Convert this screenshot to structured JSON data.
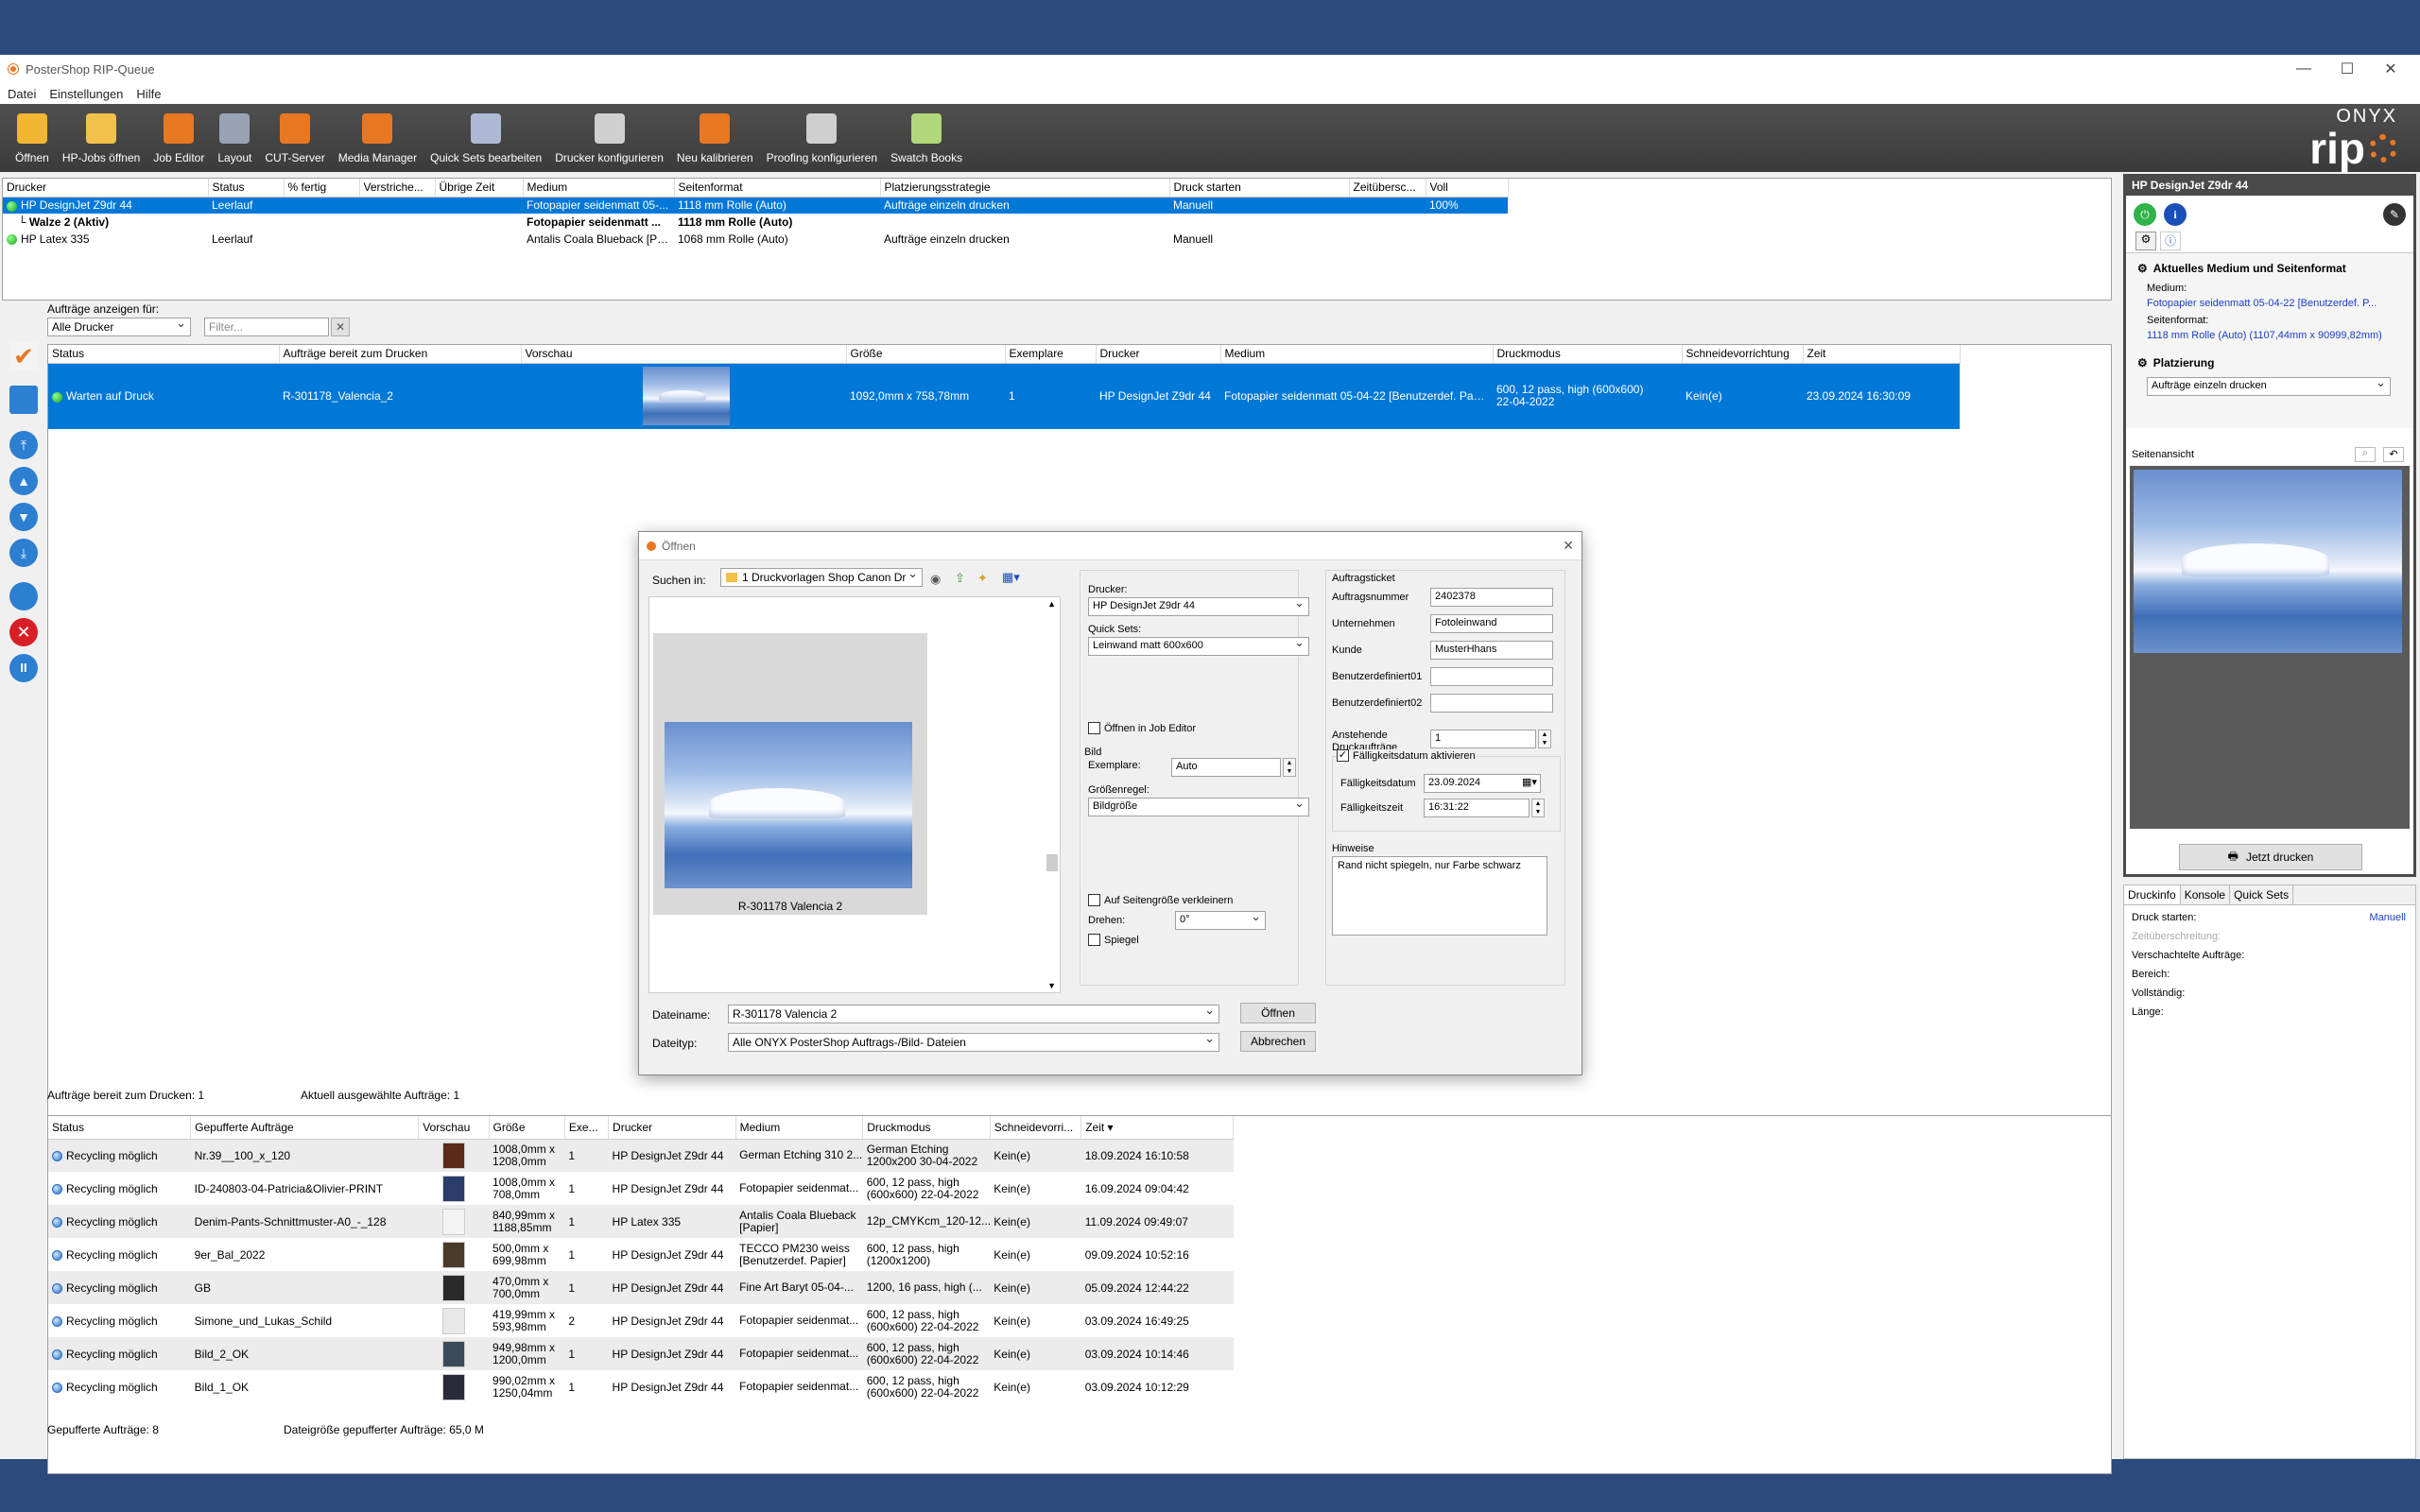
{
  "window": {
    "title": "PosterShop RIP-Queue",
    "minimize": "—",
    "maximize": "☐",
    "close": "✕"
  },
  "menu": [
    "Datei",
    "Einstellungen",
    "Hilfe"
  ],
  "toolbar": [
    {
      "label": "Öffnen",
      "icon": "folder-icon",
      "color": "#f2b632"
    },
    {
      "label": "HP-Jobs öffnen",
      "icon": "hp-folder-icon",
      "color": "#f2c14a"
    },
    {
      "label": "Job Editor",
      "icon": "job-editor-icon",
      "color": "#e87722"
    },
    {
      "label": "Layout",
      "icon": "layout-icon",
      "color": "#9aa3b5"
    },
    {
      "label": "CUT-Server",
      "icon": "cut-server-icon",
      "color": "#e87722"
    },
    {
      "label": "Media Manager",
      "icon": "media-manager-icon",
      "color": "#e87722"
    },
    {
      "label": "Quick Sets bearbeiten",
      "icon": "quick-sets-icon",
      "color": "#aeb9d6"
    },
    {
      "label": "Drucker konfigurieren",
      "icon": "printer-icon",
      "color": "#cfcfcf"
    },
    {
      "label": "Neu kalibrieren",
      "icon": "calibrate-icon",
      "color": "#e87722"
    },
    {
      "label": "Proofing konfigurieren",
      "icon": "proofing-eye-icon",
      "color": "#cfcfcf"
    },
    {
      "label": "Swatch Books",
      "icon": "swatch-icon",
      "color": "#b1d77b"
    }
  ],
  "brand": {
    "top": "ONYX",
    "bottom": "rip"
  },
  "printers": {
    "headers": [
      "Drucker",
      "Status",
      "% fertig",
      "Verstriche...",
      "Übrige Zeit",
      "Medium",
      "Seitenformat",
      "Platzierungsstrategie",
      "Druck starten",
      "Zeitübersc...",
      "Voll"
    ],
    "rows": [
      {
        "name": "HP DesignJet Z9dr 44",
        "status": "Leerlauf",
        "pct": "",
        "elapsed": "",
        "remaining": "",
        "medium": "Fotopapier seidenmatt 05-...",
        "format": "1118 mm Rolle (Auto)",
        "strategy": "Aufträge einzeln drucken",
        "start": "Manuell",
        "over": "",
        "full": "100%",
        "selected": true
      },
      {
        "name": "Walze 2 (Aktiv)",
        "status": "",
        "pct": "",
        "elapsed": "",
        "remaining": "",
        "medium": "Fotopapier seidenmatt ...",
        "format": "1118 mm Rolle (Auto)",
        "strategy": "",
        "start": "",
        "over": "",
        "full": "",
        "bold": true
      },
      {
        "name": "HP Latex 335",
        "status": "Leerlauf",
        "pct": "",
        "elapsed": "",
        "remaining": "",
        "medium": "Antalis Coala Blueback [Pap...",
        "format": "1068 mm Rolle (Auto)",
        "strategy": "Aufträge einzeln drucken",
        "start": "Manuell",
        "over": "",
        "full": ""
      }
    ]
  },
  "filter": {
    "label": "Aufträge anzeigen für:",
    "printer": "Alle Drucker",
    "placeholder": "Filter..."
  },
  "jobs": {
    "headers": [
      "Status",
      "Aufträge bereit zum Drucken",
      "Vorschau",
      "Größe",
      "Exemplare",
      "Drucker",
      "Medium",
      "Druckmodus",
      "Schneidevorrichtung",
      "Zeit"
    ],
    "rows": [
      {
        "status": "Warten auf Druck",
        "name": "R-301178_Valencia_2",
        "size": "1092,0mm x 758,78mm",
        "copies": "1",
        "printer": "HP DesignJet Z9dr 44",
        "medium": "Fotopapier seidenmatt 05-04-22 [Benutzerdef. Papier]",
        "mode1": "600, 12 pass, high (600x600)",
        "mode2": "22-04-2022",
        "cutter": "Kein(e)",
        "time": "23.09.2024 16:30:09"
      }
    ]
  },
  "status_mid": {
    "ready": "Aufträge bereit zum Drucken: 1",
    "selected": "Aktuell ausgewählte Aufträge: 1"
  },
  "buffered": {
    "headers": [
      "Status",
      "Gepufferte Aufträge",
      "Vorschau",
      "Größe",
      "Exe...",
      "Drucker",
      "Medium",
      "Druckmodus",
      "Schneidevorri...",
      "Zeit"
    ],
    "rows": [
      {
        "status": "Recycling möglich",
        "name": "Nr.39__100_x_120",
        "size1": "1008,0mm x",
        "size2": "1208,0mm",
        "copies": "1",
        "printer": "HP DesignJet Z9dr 44",
        "medium": "German Etching 310 2...",
        "mode1": "German Etching",
        "mode2": "1200x200 30-04-2022",
        "cutter": "Kein(e)",
        "time": "18.09.2024 16:10:58"
      },
      {
        "status": "Recycling möglich",
        "name": "ID-240803-04-Patricia&Olivier-PRINT",
        "size1": "1008,0mm x",
        "size2": "708,0mm",
        "copies": "1",
        "printer": "HP DesignJet Z9dr 44",
        "medium": "Fotopapier seidenmat...",
        "mode1": "600, 12 pass, high",
        "mode2": "(600x600) 22-04-2022",
        "cutter": "Kein(e)",
        "time": "16.09.2024 09:04:42"
      },
      {
        "status": "Recycling möglich",
        "name": "Denim-Pants-Schnittmuster-A0_-_128",
        "size1": "840,99mm x",
        "size2": "1188,85mm",
        "copies": "1",
        "printer": "HP Latex 335",
        "medium": "Antalis Coala Blueback",
        "medium2": "[Papier]",
        "mode1": "12p_CMYKcm_120-12...",
        "mode2": "",
        "cutter": "Kein(e)",
        "time": "11.09.2024 09:49:07"
      },
      {
        "status": "Recycling möglich",
        "name": "9er_Bal_2022",
        "size1": "500,0mm x",
        "size2": "699,98mm",
        "copies": "1",
        "printer": "HP DesignJet Z9dr 44",
        "medium": "TECCO PM230 weiss",
        "medium2": "[Benutzerdef. Papier]",
        "mode1": "600, 12 pass, high",
        "mode2": "(1200x1200)",
        "cutter": "Kein(e)",
        "time": "09.09.2024 10:52:16"
      },
      {
        "status": "Recycling möglich",
        "name": "GB",
        "size1": "470,0mm x",
        "size2": "700,0mm",
        "copies": "1",
        "printer": "HP DesignJet Z9dr 44",
        "medium": "Fine Art Baryt 05-04-...",
        "mode1": "1200, 16 pass, high (...",
        "mode2": "",
        "cutter": "Kein(e)",
        "time": "05.09.2024 12:44:22"
      },
      {
        "status": "Recycling möglich",
        "name": "Simone_und_Lukas_Schild",
        "size1": "419,99mm x",
        "size2": "593,98mm",
        "copies": "2",
        "printer": "HP DesignJet Z9dr 44",
        "medium": "Fotopapier seidenmat...",
        "mode1": "600, 12 pass, high",
        "mode2": "(600x600) 22-04-2022",
        "cutter": "Kein(e)",
        "time": "03.09.2024 16:49:25"
      },
      {
        "status": "Recycling möglich",
        "name": "Bild_2_OK",
        "size1": "949,98mm x",
        "size2": "1200,0mm",
        "copies": "1",
        "printer": "HP DesignJet Z9dr 44",
        "medium": "Fotopapier seidenmat...",
        "mode1": "600, 12 pass, high",
        "mode2": "(600x600) 22-04-2022",
        "cutter": "Kein(e)",
        "time": "03.09.2024 10:14:46"
      },
      {
        "status": "Recycling möglich",
        "name": "Bild_1_OK",
        "size1": "990,02mm x",
        "size2": "1250,04mm",
        "copies": "1",
        "printer": "HP DesignJet Z9dr 44",
        "medium": "Fotopapier seidenmat...",
        "mode1": "600, 12 pass, high",
        "mode2": "(600x600) 22-04-2022",
        "cutter": "Kein(e)",
        "time": "03.09.2024 10:12:29"
      }
    ]
  },
  "status_bottom": {
    "buffered": "Gepufferte Aufträge: 8",
    "filesize": "Dateigröße gepufferter Aufträge: 65,0 M"
  },
  "right": {
    "printer": "HP DesignJet Z9dr 44",
    "section1": "Aktuelles Medium und Seitenformat",
    "medium_label": "Medium:",
    "medium_value": "Fotopapier seidenmatt 05-04-22 [Benutzerdef. P...",
    "format_label": "Seitenformat:",
    "format_value": "1118 mm Rolle (Auto) (1107,44mm x 90999,82mm)",
    "section2": "Platzierung",
    "placement": "Aufträge einzeln drucken",
    "preview_label": "Seitenansicht",
    "print_now": "Jetzt drucken",
    "tabs": [
      "Druckinfo",
      "Konsole",
      "Quick Sets"
    ],
    "info": {
      "start_label": "Druck starten:",
      "start_value": "Manuell",
      "over": "Zeitüberschreitung:",
      "nested": "Verschachtelte Aufträge:",
      "range": "Bereich:",
      "complete": "Vollständig:",
      "length": "Länge:"
    }
  },
  "dialog": {
    "title": "Öffnen",
    "lookin_label": "Suchen in:",
    "lookin_value": "1 Druckvorlagen Shop Canon Dr",
    "thumb_caption": "R-301178 Valencia 2",
    "printer_label": "Drucker:",
    "printer_value": "HP DesignJet Z9dr 44",
    "quicksets_label": "Quick Sets:",
    "quicksets_value": "Leinwand matt 600x600",
    "open_in_editor": "Öffnen in Job Editor",
    "bild": "Bild",
    "copies_label": "Exemplare:",
    "copies_value": "Auto",
    "size_rule_label": "Größenregel:",
    "size_rule_value": "Bildgröße",
    "shrink": "Auf Seitengröße verkleinern",
    "rotate_label": "Drehen:",
    "rotate_value": "0°",
    "mirror": "Spiegel",
    "ticket": "Auftragsticket",
    "fields": [
      {
        "label": "Auftragsnummer",
        "value": "2402378"
      },
      {
        "label": "Unternehmen",
        "value": "Fotoleinwand"
      },
      {
        "label": "Kunde",
        "value": "MusterHhans"
      },
      {
        "label": "Benutzerdefiniert01",
        "value": ""
      },
      {
        "label": "Benutzerdefiniert02",
        "value": ""
      }
    ],
    "pending_label1": "Anstehende",
    "pending_label2": "Druckaufträge",
    "pending_value": "1",
    "due_enable": "Fälligkeitsdatum aktivieren",
    "due_date_label": "Fälligkeitsdatum",
    "due_date_value": "23.09.2024",
    "due_time_label": "Fälligkeitszeit",
    "due_time_value": "16:31:22",
    "notes_label": "Hinweise",
    "notes_value": "Rand nicht spiegeln, nur Farbe schwarz",
    "filename_label": "Dateiname:",
    "filename_value": "R-301178 Valencia 2",
    "filetype_label": "Dateityp:",
    "filetype_value": "Alle ONYX PosterShop Auftrags-/Bild- Dateien",
    "open_btn": "Öffnen",
    "cancel_btn": "Abbrechen"
  }
}
